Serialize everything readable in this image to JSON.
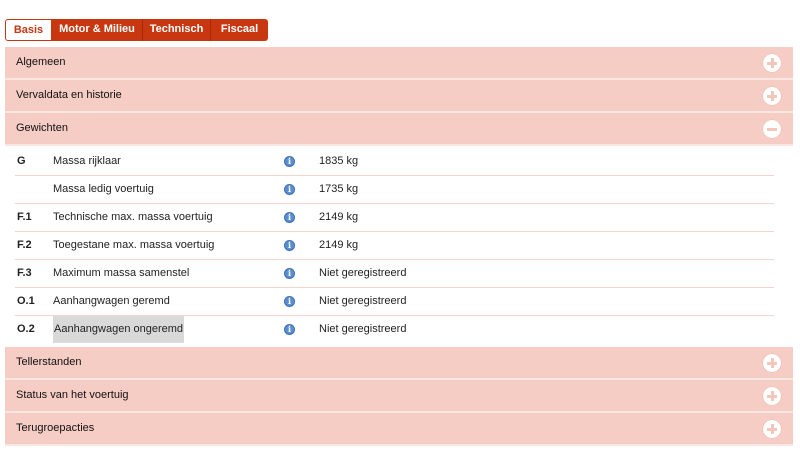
{
  "tabs": [
    {
      "label": "Basis"
    },
    {
      "label": "Motor & Milieu"
    },
    {
      "label": "Technisch"
    },
    {
      "label": "Fiscaal"
    }
  ],
  "sections": {
    "algemeen": {
      "title": "Algemeen",
      "state": "collapsed"
    },
    "vervaldata": {
      "title": "Vervaldata en historie",
      "state": "collapsed"
    },
    "gewichten": {
      "title": "Gewichten",
      "state": "expanded",
      "rows": [
        {
          "code": "G",
          "label": "Massa rijklaar",
          "value": "1835 kg"
        },
        {
          "code": "",
          "label": "Massa ledig voertuig",
          "value": "1735 kg"
        },
        {
          "code": "F.1",
          "label": "Technische max. massa voertuig",
          "value": "2149 kg"
        },
        {
          "code": "F.2",
          "label": "Toegestane max. massa voertuig",
          "value": "2149 kg"
        },
        {
          "code": "F.3",
          "label": "Maximum massa samenstel",
          "value": "Niet geregistreerd"
        },
        {
          "code": "O.1",
          "label": "Aanhangwagen geremd",
          "value": "Niet geregistreerd"
        },
        {
          "code": "O.2",
          "label": "Aanhangwagen ongeremd",
          "value": "Niet geregistreerd"
        }
      ]
    },
    "tellerstanden": {
      "title": "Tellerstanden",
      "state": "collapsed"
    },
    "status": {
      "title": "Status van het voertuig",
      "state": "collapsed"
    },
    "terugroep": {
      "title": "Terugroepacties",
      "state": "collapsed"
    }
  },
  "info_glyph": "i",
  "icons": {
    "expand": "plus-circle-icon",
    "collapse": "minus-circle-icon",
    "info": "info-icon"
  },
  "colors": {
    "accent": "#c8370f",
    "header_bg": "#f6cdc4",
    "info": "#5b8fd1"
  }
}
